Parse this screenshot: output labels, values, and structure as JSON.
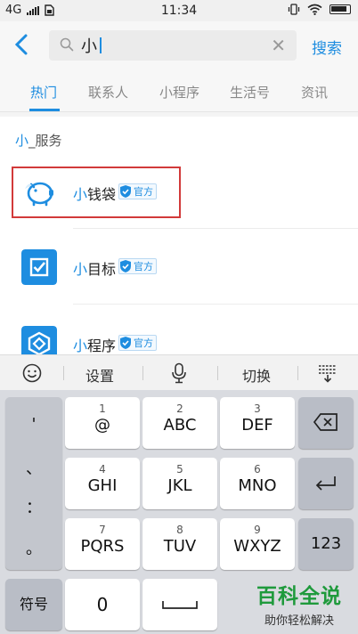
{
  "status_bar": {
    "network": "4G",
    "time": "11:34"
  },
  "search": {
    "value": "小",
    "button_label": "搜索"
  },
  "tabs": [
    {
      "label": "热门",
      "active": true
    },
    {
      "label": "联系人",
      "active": false
    },
    {
      "label": "小程序",
      "active": false
    },
    {
      "label": "生活号",
      "active": false
    },
    {
      "label": "资讯",
      "active": false
    }
  ],
  "results": {
    "section_title_hl": "小",
    "section_title_rest": "_服务",
    "items": [
      {
        "name_hl": "小",
        "name_rest": "钱袋",
        "badge": "官方",
        "icon": "piggy-bank-icon",
        "highlighted": true
      },
      {
        "name_hl": "小",
        "name_rest": "目标",
        "badge": "官方",
        "icon": "checkbox-icon",
        "highlighted": false
      },
      {
        "name_hl": "小",
        "name_rest": "程序",
        "badge": "官方",
        "icon": "mini-program-icon",
        "highlighted": false
      }
    ]
  },
  "keyboard_toolbar": {
    "settings_label": "设置",
    "switch_label": "切换"
  },
  "keyboard": {
    "punct": [
      "'",
      "、",
      "：",
      "。"
    ],
    "keys": [
      {
        "num": "1",
        "letters": "@"
      },
      {
        "num": "2",
        "letters": "ABC"
      },
      {
        "num": "3",
        "letters": "DEF"
      },
      {
        "num": "4",
        "letters": "GHI"
      },
      {
        "num": "5",
        "letters": "JKL"
      },
      {
        "num": "6",
        "letters": "MNO"
      },
      {
        "num": "7",
        "letters": "PQRS"
      },
      {
        "num": "8",
        "letters": "TUV"
      },
      {
        "num": "9",
        "letters": "WXYZ"
      }
    ],
    "symbol_label": "符号",
    "zero_label": "0",
    "num_mode_label": "123"
  },
  "watermark": {
    "title": "百科全说",
    "subtitle": "助你轻松解决"
  },
  "colors": {
    "accent": "#1e8de0",
    "highlight_box": "#d23a3a",
    "watermark": "#1f9a3c"
  }
}
